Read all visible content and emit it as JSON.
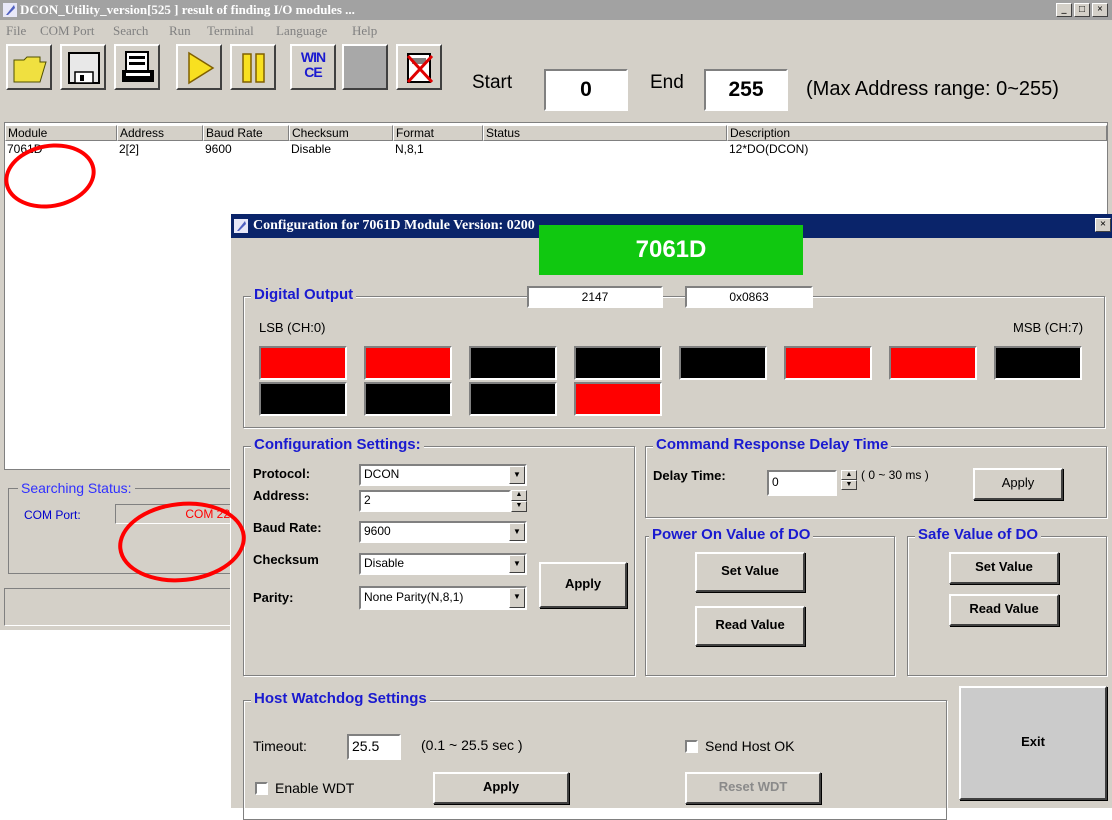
{
  "main_window": {
    "title": "DCON_Utility_version[525  ] result of finding I/O modules ...",
    "menu": [
      "File",
      "COM Port",
      "Search",
      "Run",
      "Terminal",
      "Language",
      "Help"
    ],
    "toolbar": {
      "start_label": "Start",
      "start_value": "0",
      "end_label": "End",
      "end_value": "255",
      "range_note": "(Max Address range: 0~255)",
      "wince_icon_text": "WIN CE"
    },
    "list": {
      "columns": [
        "Module",
        "Address",
        "Baud Rate",
        "Checksum",
        "Format",
        "Status",
        "Description"
      ],
      "rows": [
        {
          "module": "7061D",
          "address": "2[2]",
          "baud": "9600",
          "checksum": "Disable",
          "format": "N,8,1",
          "status": "",
          "description": "12*DO(DCON)"
        }
      ]
    },
    "searching": {
      "title": "Searching Status:",
      "com_port_label": "COM Port:",
      "com_port_value": "COM 22"
    }
  },
  "dialog": {
    "title": "Configuration for 7061D Module Version: 0200",
    "module_name": "7061D",
    "digital_output": {
      "title": "Digital Output",
      "decimal_value": "2147",
      "hex_value": "0x0863",
      "lsb_label": "LSB (CH:0)",
      "msb_label": "MSB (CH:7)",
      "channels_row1": [
        true,
        true,
        false,
        false,
        false,
        true,
        true,
        false
      ],
      "channels_row2": [
        false,
        false,
        false,
        true
      ]
    },
    "config": {
      "title": "Configuration Settings:",
      "protocol_label": "Protocol:",
      "protocol_value": "DCON",
      "address_label": "Address:",
      "address_value": "2",
      "baud_label": "Baud Rate:",
      "baud_value": "9600",
      "checksum_label": "Checksum",
      "checksum_value": "Disable",
      "parity_label": "Parity:",
      "parity_value": "None Parity(N,8,1)",
      "apply_label": "Apply"
    },
    "delay": {
      "title": "Command Response Delay Time",
      "label": "Delay Time:",
      "value": "0",
      "range": "( 0 ~ 30 ms )",
      "apply_label": "Apply"
    },
    "power_on": {
      "title": "Power On Value of DO",
      "set_label": "Set Value",
      "read_label": "Read Value"
    },
    "safe_value": {
      "title": "Safe Value of DO",
      "set_label": "Set Value",
      "read_label": "Read Value"
    },
    "watchdog": {
      "title": "Host Watchdog Settings",
      "timeout_label": "Timeout:",
      "timeout_value": "25.5",
      "timeout_range": "(0.1 ~ 25.5 sec )",
      "send_host_ok_label": "Send Host OK",
      "enable_wdt_label": "Enable WDT",
      "apply_label": "Apply",
      "reset_label": "Reset WDT"
    },
    "exit_label": "Exit"
  },
  "colors": {
    "led_on": "#ff0000",
    "led_off": "#000000",
    "badge": "#10c810",
    "group_title": "#1a1ad0",
    "annotation": "#ff0000"
  }
}
